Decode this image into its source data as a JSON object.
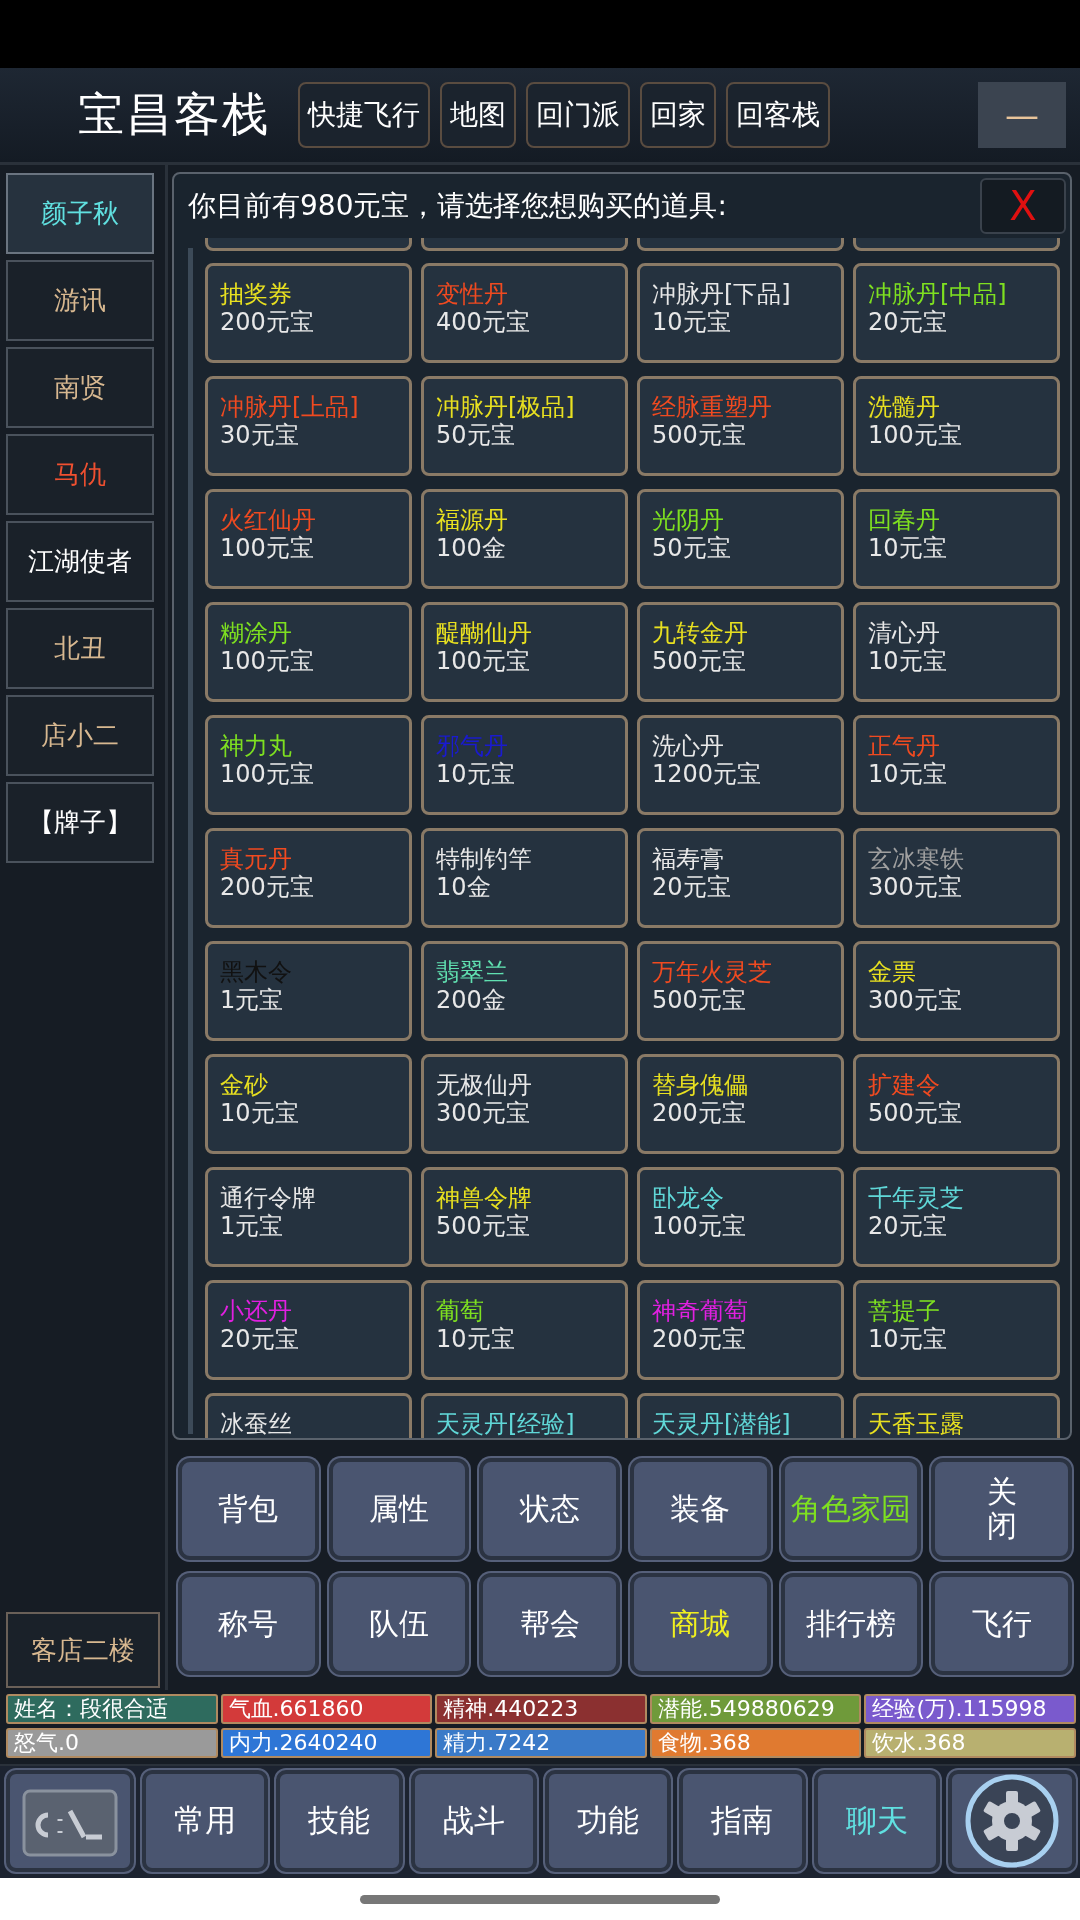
{
  "header": {
    "title": "宝昌客栈",
    "buttons": [
      "快捷飞行",
      "地图",
      "回门派",
      "回家",
      "回客栈"
    ],
    "minimize": "—"
  },
  "sidebar": {
    "items": [
      {
        "label": "颜子秋",
        "color": "#60e0e0",
        "selected": true
      },
      {
        "label": "游讯",
        "color": "#d8b890",
        "selected": false
      },
      {
        "label": "南贤",
        "color": "#d8b890",
        "selected": false
      },
      {
        "label": "马仇",
        "color": "#f05030",
        "selected": false
      },
      {
        "label": "江湖使者",
        "color": "#ffffff",
        "selected": false
      },
      {
        "label": "北丑",
        "color": "#d8b890",
        "selected": false
      },
      {
        "label": "店小二",
        "color": "#d8b890",
        "selected": false
      },
      {
        "label": "【牌子】",
        "color": "#ffffff",
        "selected": false
      }
    ],
    "footer": "客店二楼"
  },
  "shop": {
    "prompt": "你目前有980元宝，请选择您想购买的道具:",
    "close": "X",
    "items": [
      {
        "name": "抽奖券",
        "price": "200元宝",
        "color": "#e8e020"
      },
      {
        "name": "变性丹",
        "price": "400元宝",
        "color": "#f04a20"
      },
      {
        "name": "冲脉丹[下品]",
        "price": "10元宝",
        "color": "#e8e8e8"
      },
      {
        "name": "冲脉丹[中品]",
        "price": "20元宝",
        "color": "#7ee020"
      },
      {
        "name": "冲脉丹[上品]",
        "price": "30元宝",
        "color": "#f04a20"
      },
      {
        "name": "冲脉丹[极品]",
        "price": "50元宝",
        "color": "#e8e020"
      },
      {
        "name": "经脉重塑丹",
        "price": "500元宝",
        "color": "#f04a20"
      },
      {
        "name": "洗髓丹",
        "price": "100元宝",
        "color": "#e8e020"
      },
      {
        "name": "火红仙丹",
        "price": "100元宝",
        "color": "#f04a20"
      },
      {
        "name": "福源丹",
        "price": "100金",
        "color": "#e8e020"
      },
      {
        "name": "光阴丹",
        "price": "50元宝",
        "color": "#7ee020"
      },
      {
        "name": "回春丹",
        "price": "10元宝",
        "color": "#7ee020"
      },
      {
        "name": "糊涂丹",
        "price": "100元宝",
        "color": "#7ee020"
      },
      {
        "name": "醍醐仙丹",
        "price": "100元宝",
        "color": "#e8e020"
      },
      {
        "name": "九转金丹",
        "price": "500元宝",
        "color": "#e8e020"
      },
      {
        "name": "清心丹",
        "price": "10元宝",
        "color": "#e8e8e8"
      },
      {
        "name": "神力丸",
        "price": "100元宝",
        "color": "#7ee020"
      },
      {
        "name": "邪气丹",
        "price": "10元宝",
        "color": "#1a1ad0"
      },
      {
        "name": "洗心丹",
        "price": "1200元宝",
        "color": "#e8e8e8"
      },
      {
        "name": "正气丹",
        "price": "10元宝",
        "color": "#f04a20"
      },
      {
        "name": "真元丹",
        "price": "200元宝",
        "color": "#f04a20"
      },
      {
        "name": "特制钓竿",
        "price": "10金",
        "color": "#e8e8e8"
      },
      {
        "name": "福寿膏",
        "price": "20元宝",
        "color": "#e8e8e8"
      },
      {
        "name": "玄冰寒铁",
        "price": "300元宝",
        "color": "#a0a0a0"
      },
      {
        "name": "黑木令",
        "price": "1元宝",
        "color": "#111111"
      },
      {
        "name": "翡翠兰",
        "price": "200金",
        "color": "#60e0b0"
      },
      {
        "name": "万年火灵芝",
        "price": "500元宝",
        "color": "#f04a20"
      },
      {
        "name": "金票",
        "price": "300元宝",
        "color": "#e8e020"
      },
      {
        "name": "金砂",
        "price": "10元宝",
        "color": "#e8e020"
      },
      {
        "name": "无极仙丹",
        "price": "300元宝",
        "color": "#e8e8e8"
      },
      {
        "name": "替身傀儡",
        "price": "200元宝",
        "color": "#e8e020"
      },
      {
        "name": "扩建令",
        "price": "500元宝",
        "color": "#f04a20"
      },
      {
        "name": "通行令牌",
        "price": "1元宝",
        "color": "#e8e8e8"
      },
      {
        "name": "神兽令牌",
        "price": "500元宝",
        "color": "#e8e020"
      },
      {
        "name": "卧龙令",
        "price": "100元宝",
        "color": "#60d8d8"
      },
      {
        "name": "千年灵芝",
        "price": "20元宝",
        "color": "#60d8d8"
      },
      {
        "name": "小还丹",
        "price": "20元宝",
        "color": "#e020e0"
      },
      {
        "name": "葡萄",
        "price": "10元宝",
        "color": "#7ee020"
      },
      {
        "name": "神奇葡萄",
        "price": "200元宝",
        "color": "#e020e0"
      },
      {
        "name": "菩提子",
        "price": "10元宝",
        "color": "#7ee020"
      },
      {
        "name": "冰蚕丝",
        "color": "#e8e8e8"
      },
      {
        "name": "天灵丹[经验]",
        "color": "#60d8d8"
      },
      {
        "name": "天灵丹[潜能]",
        "color": "#60d8d8"
      },
      {
        "name": "天香玉露",
        "color": "#e8e020"
      }
    ]
  },
  "actions": [
    {
      "label": "背包",
      "color": "#ffffff",
      "kind": "normal"
    },
    {
      "label": "属性",
      "color": "#ffffff",
      "kind": "normal"
    },
    {
      "label": "状态",
      "color": "#ffffff",
      "kind": "normal"
    },
    {
      "label": "装备",
      "color": "#ffffff",
      "kind": "normal"
    },
    {
      "label": "角色家园",
      "color": "#7ee020",
      "kind": "normal"
    },
    {
      "label": "关闭",
      "color": "#ffffff",
      "kind": "vertical"
    },
    {
      "label": "称号",
      "color": "#ffffff",
      "kind": "normal"
    },
    {
      "label": "队伍",
      "color": "#ffffff",
      "kind": "normal"
    },
    {
      "label": "帮会",
      "color": "#ffffff",
      "kind": "normal"
    },
    {
      "label": "商城",
      "color": "#f0f020",
      "kind": "normal"
    },
    {
      "label": "排行榜",
      "color": "#ffffff",
      "kind": "normal"
    },
    {
      "label": "飞行",
      "color": "#ffffff",
      "kind": "normal"
    }
  ],
  "stats": [
    {
      "label": "姓名：段很合适",
      "color": "#2e6b5e"
    },
    {
      "label": "气血.661860",
      "color": "#d33a3a"
    },
    {
      "label": "精神.440223",
      "color": "#8b3030"
    },
    {
      "label": "潜能.549880629",
      "color": "#6f9a3a"
    },
    {
      "label": "经验(万).115998",
      "color": "#7a5acd"
    },
    {
      "label": "怒气.0",
      "color": "#9a9a9a"
    },
    {
      "label": "内力.2640240",
      "color": "#2e76d6"
    },
    {
      "label": "精力.7242",
      "color": "#3a7ac8"
    },
    {
      "label": "食物.368",
      "color": "#e07a30"
    },
    {
      "label": "饮水.368",
      "color": "#b8b070"
    }
  ],
  "nav": {
    "tabs": [
      {
        "label": "常用",
        "color": "#ffffff"
      },
      {
        "label": "技能",
        "color": "#ffffff"
      },
      {
        "label": "战斗",
        "color": "#ffffff"
      },
      {
        "label": "功能",
        "color": "#ffffff"
      },
      {
        "label": "指南",
        "color": "#ffffff"
      },
      {
        "label": "聊天",
        "color": "#60e0e0"
      }
    ]
  }
}
